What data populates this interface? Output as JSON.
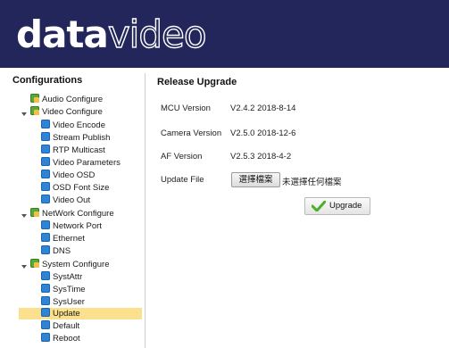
{
  "brand": {
    "part1": "data",
    "part2": "video"
  },
  "sidebar": {
    "title": "Configurations",
    "items": [
      {
        "label": "Audio Configure",
        "type": "folder"
      },
      {
        "label": "Video Configure",
        "type": "folder",
        "expanded": true
      },
      {
        "label": "Video Encode",
        "type": "item"
      },
      {
        "label": "Stream Publish",
        "type": "item"
      },
      {
        "label": "RTP Multicast",
        "type": "item"
      },
      {
        "label": "Video Parameters",
        "type": "item"
      },
      {
        "label": "Video OSD",
        "type": "item"
      },
      {
        "label": "OSD Font Size",
        "type": "item"
      },
      {
        "label": "Video Out",
        "type": "item"
      },
      {
        "label": "NetWork Configure",
        "type": "folder",
        "expanded": true
      },
      {
        "label": "Network Port",
        "type": "item"
      },
      {
        "label": "Ethernet",
        "type": "item"
      },
      {
        "label": "DNS",
        "type": "item"
      },
      {
        "label": "System Configure",
        "type": "folder",
        "expanded": true
      },
      {
        "label": "SystAttr",
        "type": "item"
      },
      {
        "label": "SysTime",
        "type": "item"
      },
      {
        "label": "SysUser",
        "type": "item"
      },
      {
        "label": "Update",
        "type": "item",
        "selected": true
      },
      {
        "label": "Default",
        "type": "item"
      },
      {
        "label": "Reboot",
        "type": "item"
      }
    ]
  },
  "main": {
    "title": "Release Upgrade",
    "rows": [
      {
        "label": "MCU Version",
        "value": "V2.4.2 2018-8-14"
      },
      {
        "label": "Camera Version",
        "value": "V2.5.0 2018-12-6"
      },
      {
        "label": "AF Version",
        "value": "V2.5.3 2018-4-2"
      }
    ],
    "update_file_label": "Update File",
    "choose_file_button": "選擇檔案",
    "no_file_text": "未選擇任何檔案",
    "upgrade_button": "Upgrade"
  },
  "colors": {
    "header_bg": "#23265a",
    "selected_bg": "#fbe08e",
    "folder_icon": "#58a83a",
    "item_icon": "#2f84d6"
  }
}
